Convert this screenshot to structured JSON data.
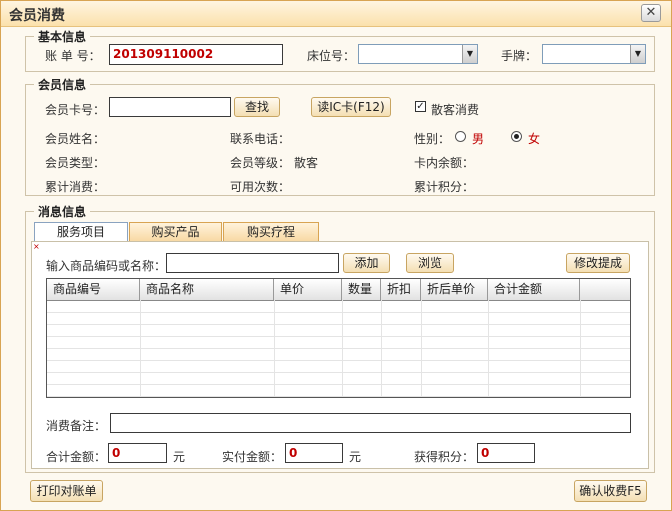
{
  "window": {
    "title": "会员消费",
    "close_glyph": "✕"
  },
  "basic": {
    "legend": "基本信息",
    "account_label": "账 单 号：",
    "account_value": "201309110002",
    "bed_label": "床位号：",
    "bed_value": "",
    "tag_label": "手牌：",
    "tag_value": ""
  },
  "member": {
    "legend": "会员信息",
    "card_label": "会员卡号：",
    "card_value": "",
    "search_btn": "查找",
    "read_ic_btn": "读IC卡(F12)",
    "guest_checkbox_label": "散客消费",
    "guest_checked": "✓",
    "name_label": "会员姓名：",
    "phone_label": "联系电话：",
    "gender_label": "性别：",
    "gender_male": "男",
    "gender_female": "女",
    "gender_selected": "女",
    "type_label": "会员类型：",
    "level_label": "会员等级：",
    "level_value": "散客",
    "balance_label": "卡内余额：",
    "total_spend_label": "累计消费：",
    "usable_times_label": "可用次数：",
    "total_points_label": "累计积分："
  },
  "consume": {
    "legend": "消息信息",
    "tabs": [
      {
        "label": "服务项目",
        "active": true
      },
      {
        "label": "购买产品",
        "active": false
      },
      {
        "label": "购买疗程",
        "active": false
      }
    ],
    "input_label": "输入商品编码或名称：",
    "input_value": "",
    "add_btn": "添加",
    "browse_btn": "浏览",
    "commission_btn": "修改提成",
    "columns": [
      "商品编号",
      "商品名称",
      "单价",
      "数量",
      "折扣",
      "折后单价",
      "合计金额",
      ""
    ],
    "remark_label": "消费备注：",
    "remark_value": "",
    "total_label": "合计金额：",
    "total_value": "0",
    "total_unit": "元",
    "paid_label": "实付金额：",
    "paid_value": "0",
    "paid_unit": "元",
    "points_label": "获得积分：",
    "points_value": "0"
  },
  "footer": {
    "print_btn": "打印对账单",
    "confirm_btn": "确认收费F5"
  }
}
